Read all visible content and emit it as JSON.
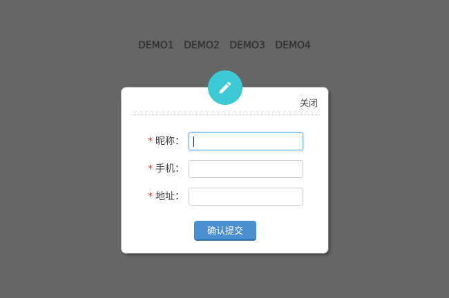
{
  "nav": {
    "items": [
      "DEMO1",
      "DEMO2",
      "DEMO3",
      "DEMO4"
    ]
  },
  "modal": {
    "icon": "pencil-icon",
    "close_label": "关闭",
    "fields": [
      {
        "required_mark": "*",
        "label": "昵称：",
        "value": "",
        "focused": true
      },
      {
        "required_mark": "*",
        "label": "手机：",
        "value": "",
        "focused": false
      },
      {
        "required_mark": "*",
        "label": "地址：",
        "value": "",
        "focused": false
      }
    ],
    "submit_label": "确认提交"
  },
  "colors": {
    "background": "#666666",
    "badge": "#3cc9d4",
    "button": "#4a8fcf",
    "required": "#e03030"
  }
}
